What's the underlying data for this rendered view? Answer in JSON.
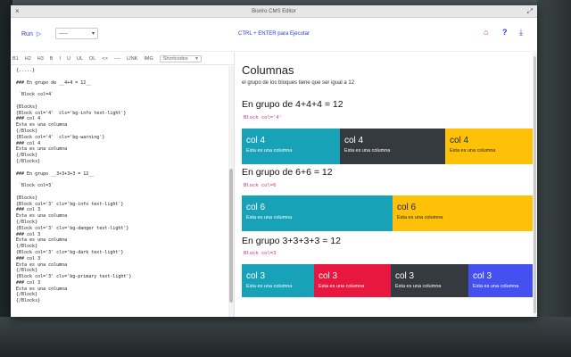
{
  "window": {
    "title": "Bioriro CMS Editor",
    "close_icon": "×",
    "expand_icon": "⤢"
  },
  "toolbar": {
    "run_label": "Run",
    "select_value": "-----",
    "hint": "CTRL + ENTER para Ejecutar"
  },
  "editor_toolbar": {
    "items": [
      "B1",
      "H2",
      "H3",
      "B",
      "I",
      "U",
      "UL",
      "OL",
      "<>",
      "----",
      "LINK",
      "IMG"
    ],
    "shortcodes_label": "Shortcodes"
  },
  "editor": {
    "lines": [
      "{.....}",
      "",
      "### En grupo de __4+4 = 12__",
      "",
      " `Block col=4`",
      "",
      "{Blocks}",
      "{Block col='4'  cls='bg-info text-light'}",
      "### col 4",
      "Esta es una columna",
      "{/Block}",
      "{Block col='4'  cls='bg-warning'}",
      "### col 4",
      "Esta es una columna",
      "{/Block}",
      "{/Blocks}",
      "",
      "### En grupo __3+3+3+3 = 12__",
      "",
      " `Block col=3`",
      "",
      "{Blocks}",
      "{Block col='3' cls='bg-info text-light'}",
      "### col 3",
      "Esta es una columna",
      "{/Block}",
      "{Block col='3' cls='bg-danger text-light'}",
      "### col 3",
      "Esta es una columna",
      "{/Block}",
      "{Block col='3' cls='bg-dark text-light'}",
      "### col 3",
      "Esta es una columna",
      "{/Block}",
      "{Block col='3' cls='bg-primary text-light'}",
      "### col 3",
      "Esta es una columna",
      "{/Block}",
      "{/Blocks}"
    ]
  },
  "preview": {
    "title": "Columnas",
    "subtitle": "el grupo de los bloques tiene que ser igual a 12",
    "groups": [
      {
        "heading": "En grupo de 4+4+4 = 12",
        "code": "Block col='4'",
        "cells": [
          {
            "title": "col 4",
            "body": "Esta es una columna",
            "bg": "#17a2b8",
            "fg": "#ffffff"
          },
          {
            "title": "col 4",
            "body": "Esta es una columna",
            "bg": "#343a40",
            "fg": "#ffffff"
          },
          {
            "title": "col 4",
            "body": "Esta es una columna",
            "bg": "#ffc107",
            "fg": "#212529"
          }
        ]
      },
      {
        "heading": "En grupo de 6+6 = 12",
        "code": "Block col=6",
        "cells": [
          {
            "title": "col 6",
            "body": "Esta es una columna",
            "bg": "#17a2b8",
            "fg": "#ffffff"
          },
          {
            "title": "col 6",
            "body": "Esta es una columna",
            "bg": "#ffc107",
            "fg": "#212529"
          }
        ]
      },
      {
        "heading": "En grupo 3+3+3+3 = 12",
        "code": "Block col=3",
        "cells": [
          {
            "title": "col 3",
            "body": "Esta es una columna",
            "bg": "#17a2b8",
            "fg": "#ffffff"
          },
          {
            "title": "col 3",
            "body": "Esta es una columna",
            "bg": "#e8173f",
            "fg": "#ffffff"
          },
          {
            "title": "col 3",
            "body": "Esta es una columna",
            "bg": "#343a40",
            "fg": "#ffffff"
          },
          {
            "title": "col 3",
            "body": "Esta es una columna",
            "bg": "#4550f0",
            "fg": "#ffffff"
          }
        ]
      }
    ]
  }
}
